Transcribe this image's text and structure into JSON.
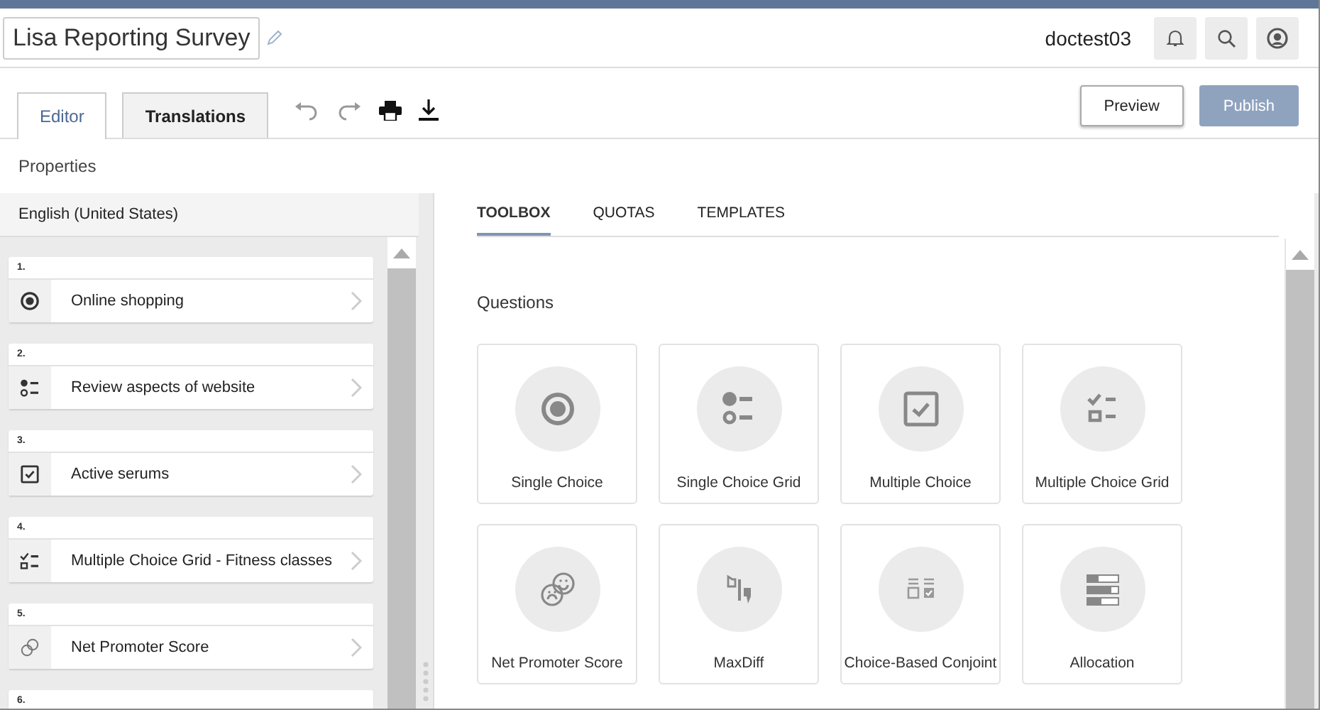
{
  "survey_title": "Lisa Reporting Survey",
  "user": "doctest03",
  "editor_tabs": [
    {
      "label": "Editor",
      "selected": true
    },
    {
      "label": "Translations",
      "selected": false
    }
  ],
  "actions": [
    {
      "label": "Preview",
      "disabled": false
    },
    {
      "label": "Publish",
      "disabled": true
    }
  ],
  "properties_label": "Properties",
  "language": "English (United States)",
  "questions": [
    {
      "number": "1.",
      "kind": "single",
      "title": "Online shopping"
    },
    {
      "number": "2.",
      "kind": "single_grid",
      "title": "Review aspects of website"
    },
    {
      "number": "3.",
      "kind": "multiple",
      "title": "Active serums"
    },
    {
      "number": "4.",
      "kind": "multiple_grid",
      "title": "Multiple Choice Grid - Fitness classes"
    },
    {
      "number": "5.",
      "kind": "nps",
      "title": "Net Promoter Score"
    },
    {
      "number": "6."
    }
  ],
  "panel_tabs": [
    {
      "label": "TOOLBOX",
      "selected": true
    },
    {
      "label": "QUOTAS",
      "selected": false
    },
    {
      "label": "TEMPLATES",
      "selected": false
    }
  ],
  "toolbox_heading": "Questions",
  "question_types": [
    {
      "kind": "single",
      "label": "Single Choice"
    },
    {
      "kind": "single_grid",
      "label": "Single Choice Grid"
    },
    {
      "kind": "multiple",
      "label": "Multiple Choice"
    },
    {
      "kind": "multiple_grid",
      "label": "Multiple Choice Grid"
    },
    {
      "kind": "nps",
      "label": "Net Promoter Score"
    },
    {
      "kind": "maxdiff",
      "label": "MaxDiff"
    },
    {
      "kind": "conjoint",
      "label": "Choice-Based Conjoint"
    },
    {
      "kind": "allocation",
      "label": "Allocation"
    }
  ]
}
